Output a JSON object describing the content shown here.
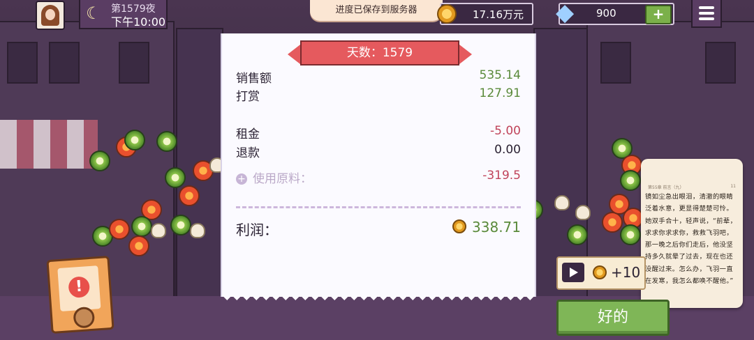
{
  "hud": {
    "night_label": "第1579夜",
    "time_label": "下午10:00",
    "toast": "进度已保存到服务器",
    "money": "17.16万元",
    "gems": "900",
    "plus_label": "+"
  },
  "receipt": {
    "banner": "天数：1579",
    "rows": [
      {
        "label": "销售额",
        "value": "535.14"
      },
      {
        "label": "打赏",
        "value": "127.91"
      },
      {
        "label": "租金",
        "value": "-5.00"
      },
      {
        "label": "退款",
        "value": "0.00"
      },
      {
        "label": "使用原料：",
        "value": "-319.5"
      }
    ],
    "profit_label": "利润：",
    "profit_value": "338.71"
  },
  "reward": {
    "amount": "+10"
  },
  "ok_button": "好的",
  "novel": {
    "header_left": "第55章 前言（九）",
    "header_right": "11",
    "text": "镜如尘急出眼泪，清澈的眼睛泛着水意，更显得楚楚可怜。她双手合十，轻声说，“前辈，求求你求求你，救救飞羽吧，那一晚之后你们走后，他没坚持多久就晕了过去，现在也还没醒过来。怎么办，飞羽一直在发寒，我怎么都唤不醒他。”"
  },
  "colors": {
    "accent_green": "#7fb657",
    "banner_red": "#e55a5e",
    "negative": "#c0435a",
    "positive": "#5a8a3a"
  }
}
